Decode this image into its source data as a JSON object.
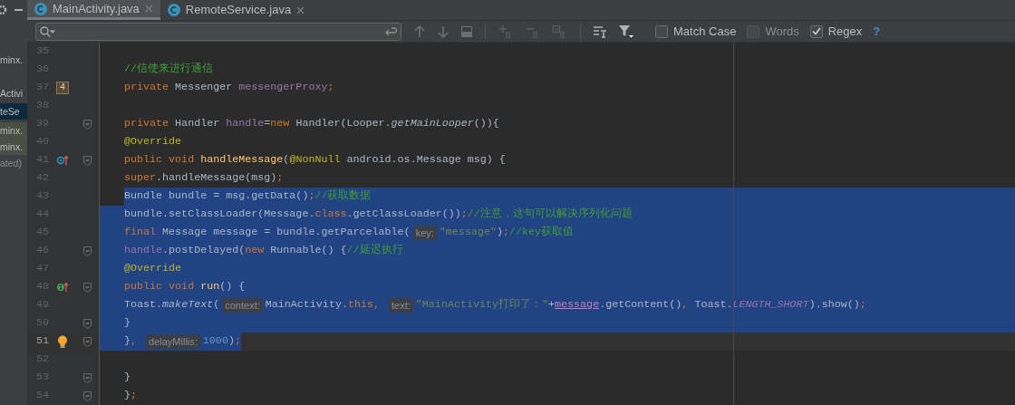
{
  "sidebar": {
    "items": [
      {
        "label": "minx.",
        "kind": "normal"
      },
      {
        "label": "Activi",
        "kind": "normal"
      },
      {
        "label": "teSe",
        "kind": "selected"
      },
      {
        "label": "minx.",
        "kind": "modified"
      },
      {
        "label": "minx.",
        "kind": "modified"
      },
      {
        "label": "ated)",
        "kind": "dim"
      }
    ]
  },
  "tabs": [
    {
      "label": "MainActivity.java",
      "selected": true
    },
    {
      "label": "RemoteService.java",
      "selected": false
    }
  ],
  "search": {
    "options": [
      {
        "label": "Match Case",
        "checked": false,
        "disabled": false
      },
      {
        "label": "Words",
        "checked": false,
        "disabled": true
      },
      {
        "label": "Regex",
        "checked": true,
        "disabled": false
      }
    ],
    "help": "?"
  },
  "editor": {
    "lines": [
      {
        "number": "35",
        "selected": false,
        "current": false,
        "fold": false
      },
      {
        "number": "36",
        "selected": false,
        "current": false,
        "fold": false,
        "code": [
          {
            "kind": "comment",
            "t": "    //信使来进行通信"
          }
        ]
      },
      {
        "number": "37",
        "selected": false,
        "current": false,
        "fold": false,
        "marker": {
          "kind": "badge",
          "label": "4"
        },
        "code": [
          {
            "kind": "kw",
            "t": "    private "
          },
          {
            "kind": "plain",
            "t": "Messenger "
          },
          {
            "kind": "field",
            "t": "messengerProxy"
          },
          {
            "kind": "kw",
            "t": ";"
          }
        ]
      },
      {
        "number": "38",
        "selected": false,
        "current": false,
        "fold": false
      },
      {
        "number": "39",
        "selected": false,
        "current": false,
        "fold": true,
        "code": [
          {
            "kind": "kw",
            "t": "    private "
          },
          {
            "kind": "plain",
            "t": "Handler "
          },
          {
            "kind": "field",
            "t": "handle"
          },
          {
            "kind": "plain",
            "t": "="
          },
          {
            "kind": "kw",
            "t": "new "
          },
          {
            "kind": "plain",
            "t": "Handler(Looper."
          },
          {
            "kind": "italic",
            "t": "getMainLooper"
          },
          {
            "kind": "plain",
            "t": "()){"
          }
        ]
      },
      {
        "number": "40",
        "selected": false,
        "current": false,
        "fold": false,
        "code": [
          {
            "kind": "annot",
            "t": "        @Override"
          }
        ]
      },
      {
        "number": "41",
        "selected": false,
        "current": false,
        "fold": true,
        "marker": {
          "kind": "override"
        },
        "code": [
          {
            "kind": "kw",
            "t": "        public void "
          },
          {
            "kind": "method",
            "t": "handleMessage"
          },
          {
            "kind": "plain",
            "t": "("
          },
          {
            "kind": "annot",
            "t": "@NonNull"
          },
          {
            "kind": "plain",
            "t": " android.os.Message msg) {"
          }
        ]
      },
      {
        "number": "42",
        "selected": false,
        "current": false,
        "fold": false,
        "code": [
          {
            "kind": "kw",
            "t": "            super"
          },
          {
            "kind": "plain",
            "t": ".handleMessage(msg)"
          },
          {
            "kind": "kw",
            "t": ";"
          }
        ]
      },
      {
        "number": "43",
        "selected": true,
        "current": false,
        "fold": false,
        "code": [
          {
            "kind": "plain",
            "t": "            Bundle bundle = msg.getData()"
          },
          {
            "kind": "kw",
            "t": ";"
          },
          {
            "kind": "comment",
            "t": "//获取数据"
          }
        ]
      },
      {
        "number": "44",
        "selected": true,
        "current": false,
        "fold": false,
        "code": [
          {
            "kind": "plain",
            "t": "            bundle.setClassLoader(Message."
          },
          {
            "kind": "kw",
            "t": "class"
          },
          {
            "kind": "plain",
            "t": ".getClassLoader())"
          },
          {
            "kind": "kw",
            "t": ";"
          },
          {
            "kind": "comment",
            "t": "//注意，这句可以解决序列化问题"
          }
        ]
      },
      {
        "number": "45",
        "selected": true,
        "current": false,
        "fold": false,
        "code": [
          {
            "kind": "kw",
            "t": "            final "
          },
          {
            "kind": "plain",
            "t": "Message message = bundle.getParcelable("
          },
          {
            "kind": "hint",
            "t": "key:"
          },
          {
            "kind": "string",
            "t": "\"message\""
          },
          {
            "kind": "plain",
            "t": ")"
          },
          {
            "kind": "kw",
            "t": ";"
          },
          {
            "kind": "comment",
            "t": "//key获取值"
          }
        ]
      },
      {
        "number": "46",
        "selected": true,
        "current": false,
        "fold": true,
        "code": [
          {
            "kind": "field",
            "t": "            handle"
          },
          {
            "kind": "plain",
            "t": ".postDelayed("
          },
          {
            "kind": "kw",
            "t": "new "
          },
          {
            "kind": "plain",
            "t": "Runnable() {"
          },
          {
            "kind": "comment",
            "t": "//延迟执行"
          }
        ]
      },
      {
        "number": "47",
        "selected": true,
        "current": false,
        "fold": false,
        "code": [
          {
            "kind": "annot",
            "t": "                @Override"
          }
        ]
      },
      {
        "number": "48",
        "selected": true,
        "current": false,
        "fold": true,
        "marker": {
          "kind": "implement"
        },
        "code": [
          {
            "kind": "kw",
            "t": "                public void "
          },
          {
            "kind": "method",
            "t": "run"
          },
          {
            "kind": "plain",
            "t": "() {"
          }
        ]
      },
      {
        "number": "49",
        "selected": true,
        "current": false,
        "fold": false,
        "code": [
          {
            "kind": "plain",
            "t": "                    Toast."
          },
          {
            "kind": "italic",
            "t": "makeText"
          },
          {
            "kind": "plain",
            "t": "("
          },
          {
            "kind": "hint",
            "t": "context:"
          },
          {
            "kind": "plain",
            "t": "MainActivity."
          },
          {
            "kind": "kw",
            "t": "this, "
          },
          {
            "kind": "hint",
            "t": "text:"
          },
          {
            "kind": "string",
            "t": "\"MainActivity打印了：\""
          },
          {
            "kind": "plain",
            "t": "+"
          },
          {
            "kind": "underline",
            "t": "message"
          },
          {
            "kind": "plain",
            "t": ".getContent()"
          },
          {
            "kind": "kw",
            "t": ", "
          },
          {
            "kind": "plain",
            "t": "Toast."
          },
          {
            "kind": "static",
            "t": "LENGTH_SHORT"
          },
          {
            "kind": "plain",
            "t": ").show()"
          },
          {
            "kind": "kw",
            "t": ";"
          }
        ]
      },
      {
        "number": "50",
        "selected": true,
        "current": false,
        "fold": true,
        "code": [
          {
            "kind": "plain",
            "t": "                }"
          }
        ]
      },
      {
        "number": "51",
        "selected": true,
        "current": true,
        "fold": true,
        "marker": {
          "kind": "bulb"
        },
        "code": [
          {
            "kind": "plain",
            "t": "            }"
          },
          {
            "kind": "kw",
            "t": ", "
          },
          {
            "kind": "hint",
            "t": "delayMillis:"
          },
          {
            "kind": "num",
            "t": "1000"
          },
          {
            "kind": "plain",
            "t": ")"
          },
          {
            "kind": "kw",
            "t": ";"
          }
        ]
      },
      {
        "number": "52",
        "selected": false,
        "current": false,
        "fold": false
      },
      {
        "number": "53",
        "selected": false,
        "current": false,
        "fold": true,
        "code": [
          {
            "kind": "plain",
            "t": "        }"
          }
        ]
      },
      {
        "number": "54",
        "selected": false,
        "current": false,
        "fold": true,
        "code": [
          {
            "kind": "plain",
            "t": "    }"
          },
          {
            "kind": "kw",
            "t": ";"
          }
        ]
      }
    ]
  }
}
